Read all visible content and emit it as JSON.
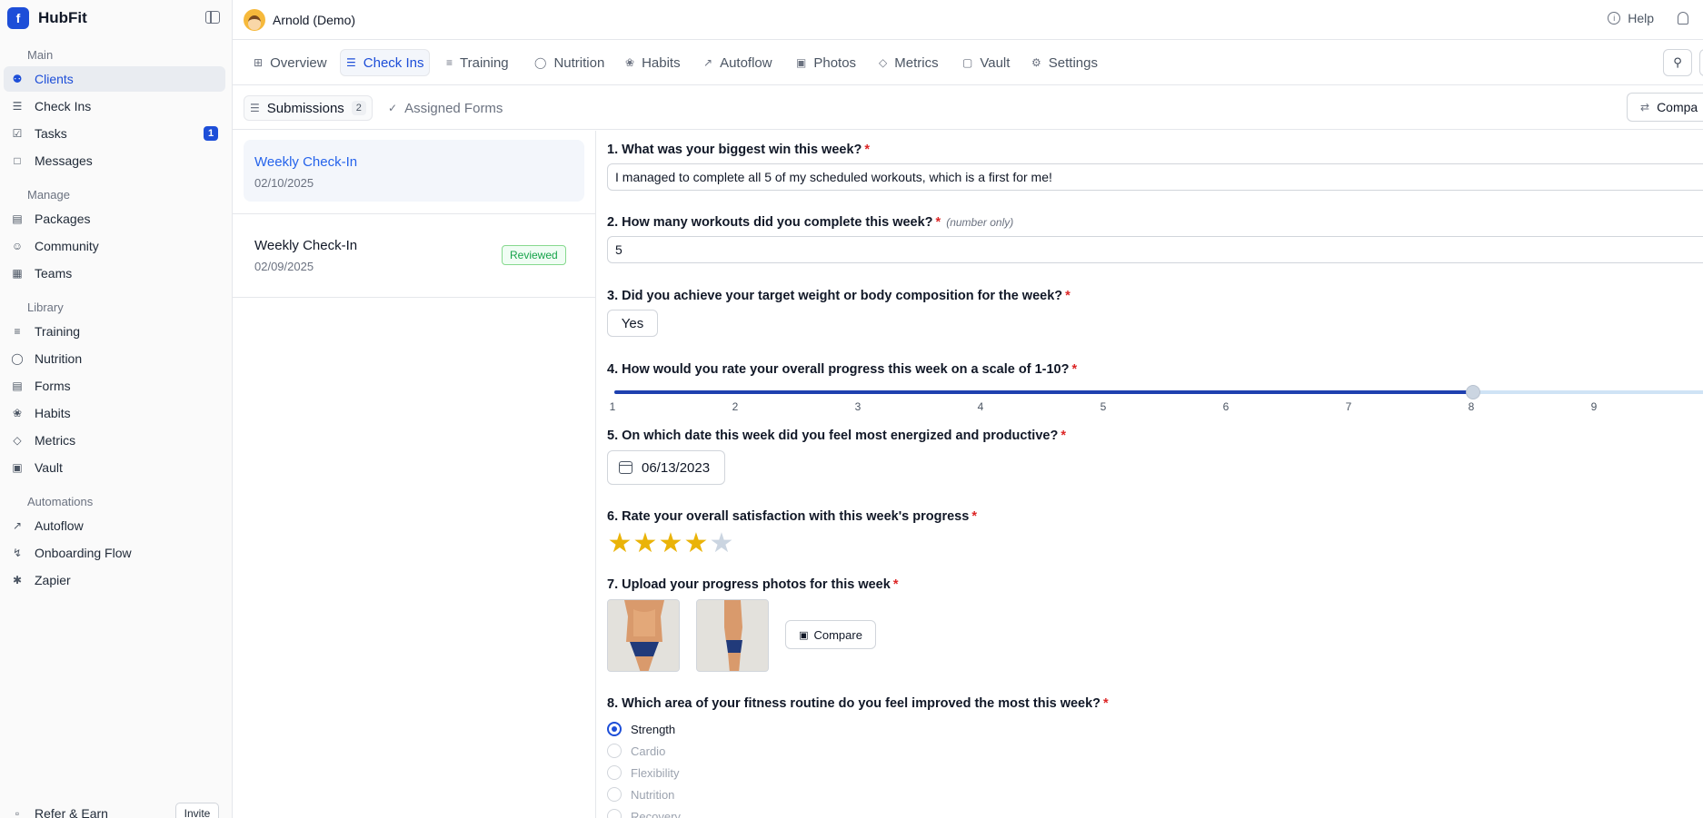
{
  "app": {
    "name": "HubFit"
  },
  "sidebar": {
    "sections": [
      "Main",
      "Manage",
      "Library",
      "Automations"
    ],
    "items": [
      {
        "label": "Clients",
        "icon": "users-icon"
      },
      {
        "label": "Check Ins",
        "icon": "checklist-icon"
      },
      {
        "label": "Tasks",
        "icon": "task-icon",
        "badge": "1"
      },
      {
        "label": "Messages",
        "icon": "message-icon"
      },
      {
        "label": "Packages",
        "icon": "package-icon"
      },
      {
        "label": "Community",
        "icon": "smile-icon"
      },
      {
        "label": "Teams",
        "icon": "building-icon"
      },
      {
        "label": "Training",
        "icon": "dumbbell-icon"
      },
      {
        "label": "Nutrition",
        "icon": "avocado-icon"
      },
      {
        "label": "Forms",
        "icon": "form-icon"
      },
      {
        "label": "Habits",
        "icon": "sprout-icon"
      },
      {
        "label": "Metrics",
        "icon": "ruler-icon"
      },
      {
        "label": "Vault",
        "icon": "vault-icon"
      },
      {
        "label": "Autoflow",
        "icon": "flow-icon"
      },
      {
        "label": "Onboarding Flow",
        "icon": "bolt-icon"
      },
      {
        "label": "Zapier",
        "icon": "asterisk-icon"
      }
    ],
    "footer": {
      "refer_label": "Refer & Earn",
      "invite_label": "Invite"
    }
  },
  "header": {
    "client_name": "Arnold (Demo)",
    "help_label": "Help"
  },
  "tabs": [
    "Overview",
    "Check Ins",
    "Training",
    "Nutrition",
    "Habits",
    "Autoflow",
    "Photos",
    "Metrics",
    "Vault",
    "Settings"
  ],
  "subtabs": {
    "submissions_label": "Submissions",
    "submissions_count": "2",
    "assigned_label": "Assigned Forms",
    "compare_label": "Compa"
  },
  "submissions": [
    {
      "title": "Weekly Check-In",
      "date": "02/10/2025"
    },
    {
      "title": "Weekly Check-In",
      "date": "02/09/2025",
      "status": "Reviewed"
    }
  ],
  "questions": {
    "q1": {
      "label": "1. What was your biggest win this week?",
      "answer": "I managed to complete all 5 of my scheduled workouts, which is a first for me!"
    },
    "q2": {
      "label": "2. How many workouts did you complete this week?",
      "hint": "(number only)",
      "answer": "5"
    },
    "q3": {
      "label": "3. Did you achieve your target weight or body composition for the week?",
      "answer": "Yes"
    },
    "q4": {
      "label": "4. How would you rate your overall progress this week on a scale of 1-10?",
      "value": 8,
      "min": 1,
      "max": 10,
      "ticks": [
        "1",
        "2",
        "3",
        "4",
        "5",
        "6",
        "7",
        "8",
        "9"
      ]
    },
    "q5": {
      "label": "5. On which date this week did you feel most energized and productive?",
      "answer": "06/13/2023"
    },
    "q6": {
      "label": "6. Rate your overall satisfaction with this week's progress",
      "rating": 4,
      "max": 5
    },
    "q7": {
      "label": "7. Upload your progress photos for this week",
      "compare_label": "Compare"
    },
    "q8": {
      "label": "8. Which area of your fitness routine do you feel improved the most this week?",
      "options": [
        "Strength",
        "Cardio",
        "Flexibility",
        "Nutrition",
        "Recovery"
      ],
      "selected": "Strength"
    }
  },
  "required_mark": "*",
  "colors": {
    "accent": "#1d4ed8",
    "required": "#dc2626",
    "star": "#eab308",
    "reviewed": "#16a34a"
  }
}
